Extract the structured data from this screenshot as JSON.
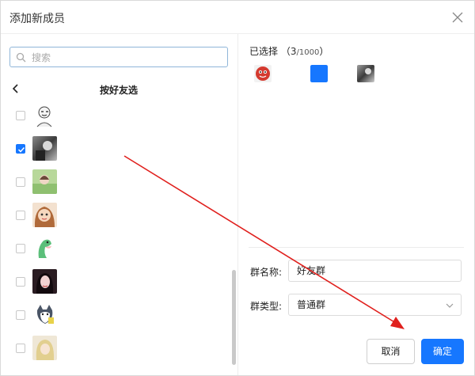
{
  "dialog": {
    "title": "添加新成员"
  },
  "search": {
    "placeholder": "搜索"
  },
  "filter": {
    "title": "按好友选"
  },
  "friends": [
    {
      "checked": false,
      "avatar": "meme-cartoon-avatar"
    },
    {
      "checked": true,
      "avatar": "grayscale-photo-avatar"
    },
    {
      "checked": false,
      "avatar": "green-field-avatar"
    },
    {
      "checked": false,
      "avatar": "anime-girl-avatar"
    },
    {
      "checked": false,
      "avatar": "green-dinosaur-avatar"
    },
    {
      "checked": false,
      "avatar": "dark-hair-girl-avatar"
    },
    {
      "checked": false,
      "avatar": "husky-dog-avatar"
    },
    {
      "checked": false,
      "avatar": "blonde-girl-avatar"
    }
  ],
  "selected": {
    "label": "已选择",
    "count": "3",
    "max": "/1000",
    "open_paren": "（",
    "close_paren": "）",
    "avatars": [
      "red-cartoon-avatar",
      "blue-square-avatar",
      "grayscale-photo-avatar"
    ]
  },
  "form": {
    "name_label": "群名称:",
    "name_value": "好友群",
    "type_label": "群类型:",
    "type_value": "普通群"
  },
  "buttons": {
    "cancel": "取消",
    "confirm": "确定"
  },
  "colors": {
    "accent": "#1677ff",
    "arrow": "#e0201d"
  }
}
